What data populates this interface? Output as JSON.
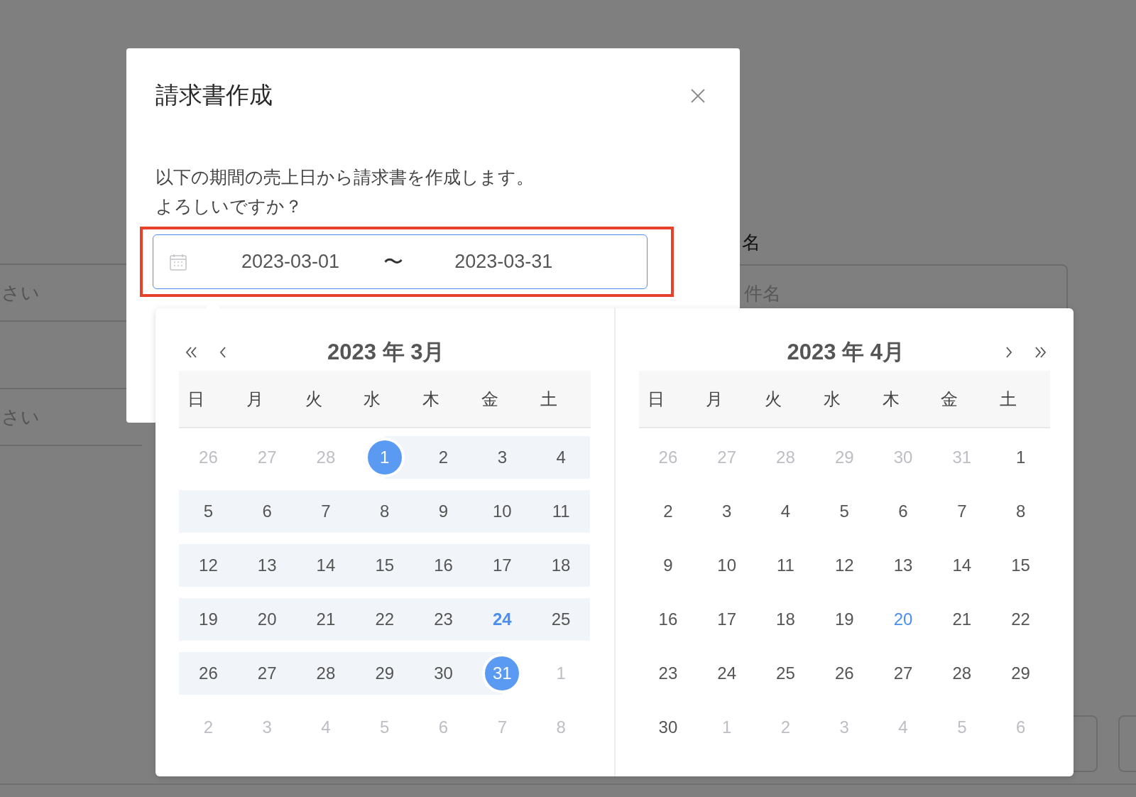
{
  "background": {
    "field_hints": [
      "さい",
      "さい"
    ],
    "field_label": "名",
    "field_placeholder": "件名"
  },
  "dialog": {
    "title": "請求書作成",
    "message": [
      "以下の期間の売上日から請求書を作成します。",
      "よろしいですか？"
    ],
    "range": {
      "start": "2023-03-01",
      "separator": "〜",
      "end": "2023-03-31",
      "focused": true,
      "highlighted": true
    }
  },
  "calendars": [
    {
      "title": "2023 年 3月",
      "nav": [
        {
          "kind": "prev-year"
        },
        {
          "kind": "prev-month"
        }
      ],
      "weekdays": [
        "日",
        "月",
        "火",
        "水",
        "木",
        "金",
        "土"
      ],
      "weeks": [
        [
          {
            "day": "26",
            "kind": "other",
            "in_range": false,
            "selected": false
          },
          {
            "day": "27",
            "kind": "other",
            "in_range": false,
            "selected": false
          },
          {
            "day": "28",
            "kind": "other",
            "in_range": false,
            "selected": false
          },
          {
            "day": "1",
            "kind": "normal",
            "in_range": true,
            "selected": true
          },
          {
            "day": "2",
            "kind": "normal",
            "in_range": true,
            "selected": false
          },
          {
            "day": "3",
            "kind": "normal",
            "in_range": true,
            "selected": false
          },
          {
            "day": "4",
            "kind": "normal",
            "in_range": true,
            "selected": false
          }
        ],
        [
          {
            "day": "5",
            "kind": "normal",
            "in_range": true,
            "selected": false
          },
          {
            "day": "6",
            "kind": "normal",
            "in_range": true,
            "selected": false
          },
          {
            "day": "7",
            "kind": "normal",
            "in_range": true,
            "selected": false
          },
          {
            "day": "8",
            "kind": "normal",
            "in_range": true,
            "selected": false
          },
          {
            "day": "9",
            "kind": "normal",
            "in_range": true,
            "selected": false
          },
          {
            "day": "10",
            "kind": "normal",
            "in_range": true,
            "selected": false
          },
          {
            "day": "11",
            "kind": "normal",
            "in_range": true,
            "selected": false
          }
        ],
        [
          {
            "day": "12",
            "kind": "normal",
            "in_range": true,
            "selected": false
          },
          {
            "day": "13",
            "kind": "normal",
            "in_range": true,
            "selected": false
          },
          {
            "day": "14",
            "kind": "normal",
            "in_range": true,
            "selected": false
          },
          {
            "day": "15",
            "kind": "normal",
            "in_range": true,
            "selected": false
          },
          {
            "day": "16",
            "kind": "normal",
            "in_range": true,
            "selected": false
          },
          {
            "day": "17",
            "kind": "normal",
            "in_range": true,
            "selected": false
          },
          {
            "day": "18",
            "kind": "normal",
            "in_range": true,
            "selected": false
          }
        ],
        [
          {
            "day": "19",
            "kind": "normal",
            "in_range": true,
            "selected": false
          },
          {
            "day": "20",
            "kind": "normal",
            "in_range": true,
            "selected": false
          },
          {
            "day": "21",
            "kind": "normal",
            "in_range": true,
            "selected": false
          },
          {
            "day": "22",
            "kind": "normal",
            "in_range": true,
            "selected": false
          },
          {
            "day": "23",
            "kind": "normal",
            "in_range": true,
            "selected": false
          },
          {
            "day": "24",
            "kind": "today",
            "in_range": true,
            "selected": false
          },
          {
            "day": "25",
            "kind": "normal",
            "in_range": true,
            "selected": false
          }
        ],
        [
          {
            "day": "26",
            "kind": "normal",
            "in_range": true,
            "selected": false
          },
          {
            "day": "27",
            "kind": "normal",
            "in_range": true,
            "selected": false
          },
          {
            "day": "28",
            "kind": "normal",
            "in_range": true,
            "selected": false
          },
          {
            "day": "29",
            "kind": "normal",
            "in_range": true,
            "selected": false
          },
          {
            "day": "30",
            "kind": "normal",
            "in_range": true,
            "selected": false
          },
          {
            "day": "31",
            "kind": "normal",
            "in_range": true,
            "selected": true
          },
          {
            "day": "1",
            "kind": "other",
            "in_range": false,
            "selected": false
          }
        ],
        [
          {
            "day": "2",
            "kind": "other",
            "in_range": false,
            "selected": false
          },
          {
            "day": "3",
            "kind": "other",
            "in_range": false,
            "selected": false
          },
          {
            "day": "4",
            "kind": "other",
            "in_range": false,
            "selected": false
          },
          {
            "day": "5",
            "kind": "other",
            "in_range": false,
            "selected": false
          },
          {
            "day": "6",
            "kind": "other",
            "in_range": false,
            "selected": false
          },
          {
            "day": "7",
            "kind": "other",
            "in_range": false,
            "selected": false
          },
          {
            "day": "8",
            "kind": "other",
            "in_range": false,
            "selected": false
          }
        ]
      ]
    },
    {
      "title": "2023 年 4月",
      "nav": [
        {
          "kind": "next-month"
        },
        {
          "kind": "next-year"
        }
      ],
      "weekdays": [
        "日",
        "月",
        "火",
        "水",
        "木",
        "金",
        "土"
      ],
      "weeks": [
        [
          {
            "day": "26",
            "kind": "other",
            "in_range": false,
            "selected": false
          },
          {
            "day": "27",
            "kind": "other",
            "in_range": false,
            "selected": false
          },
          {
            "day": "28",
            "kind": "other",
            "in_range": false,
            "selected": false
          },
          {
            "day": "29",
            "kind": "other",
            "in_range": false,
            "selected": false
          },
          {
            "day": "30",
            "kind": "other",
            "in_range": false,
            "selected": false
          },
          {
            "day": "31",
            "kind": "other",
            "in_range": false,
            "selected": false
          },
          {
            "day": "1",
            "kind": "normal",
            "in_range": false,
            "selected": false
          }
        ],
        [
          {
            "day": "2",
            "kind": "normal",
            "in_range": false,
            "selected": false
          },
          {
            "day": "3",
            "kind": "normal",
            "in_range": false,
            "selected": false
          },
          {
            "day": "4",
            "kind": "normal",
            "in_range": false,
            "selected": false
          },
          {
            "day": "5",
            "kind": "normal",
            "in_range": false,
            "selected": false
          },
          {
            "day": "6",
            "kind": "normal",
            "in_range": false,
            "selected": false
          },
          {
            "day": "7",
            "kind": "normal",
            "in_range": false,
            "selected": false
          },
          {
            "day": "8",
            "kind": "normal",
            "in_range": false,
            "selected": false
          }
        ],
        [
          {
            "day": "9",
            "kind": "normal",
            "in_range": false,
            "selected": false
          },
          {
            "day": "10",
            "kind": "normal",
            "in_range": false,
            "selected": false
          },
          {
            "day": "11",
            "kind": "normal",
            "in_range": false,
            "selected": false
          },
          {
            "day": "12",
            "kind": "normal",
            "in_range": false,
            "selected": false
          },
          {
            "day": "13",
            "kind": "normal",
            "in_range": false,
            "selected": false
          },
          {
            "day": "14",
            "kind": "normal",
            "in_range": false,
            "selected": false
          },
          {
            "day": "15",
            "kind": "normal",
            "in_range": false,
            "selected": false
          }
        ],
        [
          {
            "day": "16",
            "kind": "normal",
            "in_range": false,
            "selected": false
          },
          {
            "day": "17",
            "kind": "normal",
            "in_range": false,
            "selected": false
          },
          {
            "day": "18",
            "kind": "normal",
            "in_range": false,
            "selected": false
          },
          {
            "day": "19",
            "kind": "normal",
            "in_range": false,
            "selected": false
          },
          {
            "day": "20",
            "kind": "marked",
            "in_range": false,
            "selected": false
          },
          {
            "day": "21",
            "kind": "normal",
            "in_range": false,
            "selected": false
          },
          {
            "day": "22",
            "kind": "normal",
            "in_range": false,
            "selected": false
          }
        ],
        [
          {
            "day": "23",
            "kind": "normal",
            "in_range": false,
            "selected": false
          },
          {
            "day": "24",
            "kind": "normal",
            "in_range": false,
            "selected": false
          },
          {
            "day": "25",
            "kind": "normal",
            "in_range": false,
            "selected": false
          },
          {
            "day": "26",
            "kind": "normal",
            "in_range": false,
            "selected": false
          },
          {
            "day": "27",
            "kind": "normal",
            "in_range": false,
            "selected": false
          },
          {
            "day": "28",
            "kind": "normal",
            "in_range": false,
            "selected": false
          },
          {
            "day": "29",
            "kind": "normal",
            "in_range": false,
            "selected": false
          }
        ],
        [
          {
            "day": "30",
            "kind": "normal",
            "in_range": false,
            "selected": false
          },
          {
            "day": "1",
            "kind": "other",
            "in_range": false,
            "selected": false
          },
          {
            "day": "2",
            "kind": "other",
            "in_range": false,
            "selected": false
          },
          {
            "day": "3",
            "kind": "other",
            "in_range": false,
            "selected": false
          },
          {
            "day": "4",
            "kind": "other",
            "in_range": false,
            "selected": false
          },
          {
            "day": "5",
            "kind": "other",
            "in_range": false,
            "selected": false
          },
          {
            "day": "6",
            "kind": "other",
            "in_range": false,
            "selected": false
          }
        ]
      ]
    }
  ]
}
